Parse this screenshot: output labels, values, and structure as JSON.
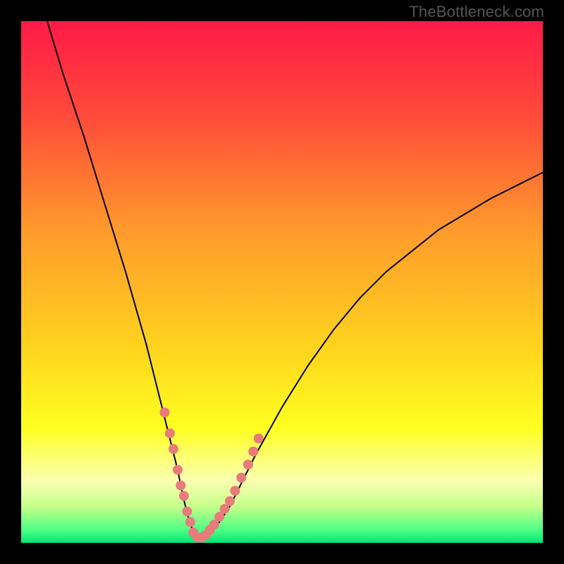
{
  "watermark": "TheBottleneck.com",
  "colors": {
    "frame": "#000000",
    "curve": "#000000",
    "marker": "#e87b7b",
    "gradient_stops": [
      {
        "offset": 0.0,
        "color": "#ff1a48"
      },
      {
        "offset": 0.18,
        "color": "#ff4a3a"
      },
      {
        "offset": 0.4,
        "color": "#ff9a2c"
      },
      {
        "offset": 0.62,
        "color": "#ffd21e"
      },
      {
        "offset": 0.78,
        "color": "#ffff20"
      },
      {
        "offset": 0.88,
        "color": "#faffb0"
      },
      {
        "offset": 0.93,
        "color": "#c6ff8a"
      },
      {
        "offset": 0.975,
        "color": "#4eff84"
      },
      {
        "offset": 1.0,
        "color": "#00e676"
      }
    ]
  },
  "chart_data": {
    "type": "line",
    "title": "",
    "xlabel": "",
    "ylabel": "",
    "xlim": [
      0,
      100
    ],
    "ylim": [
      0,
      100
    ],
    "grid": false,
    "legend": false,
    "series": [
      {
        "name": "bottleneck-curve",
        "x": [
          5,
          8,
          12,
          16,
          20,
          24,
          26,
          28,
          30,
          31,
          32,
          33,
          34,
          35,
          36,
          38,
          40,
          42,
          45,
          50,
          55,
          60,
          65,
          70,
          80,
          90,
          100
        ],
        "y": [
          100,
          90,
          78,
          65,
          52,
          38,
          30,
          22,
          14,
          9,
          5,
          2,
          1,
          1,
          2,
          4,
          7,
          11,
          17,
          26,
          34,
          41,
          47,
          52,
          60,
          66,
          71
        ]
      }
    ],
    "markers": {
      "name": "highlighted-points",
      "x": [
        27.5,
        28.5,
        29.2,
        30.0,
        30.6,
        31.2,
        31.8,
        32.4,
        33.0,
        33.8,
        34.6,
        35.4,
        36.2,
        37.0,
        38.0,
        39.0,
        40.0,
        41.0,
        42.2,
        43.5,
        44.5,
        45.5
      ],
      "y": [
        25,
        21,
        18,
        14,
        11,
        9,
        6,
        4,
        2,
        1,
        1,
        1.5,
        2.5,
        3.5,
        5,
        6.5,
        8,
        10,
        12.5,
        15,
        17.5,
        20
      ]
    }
  }
}
